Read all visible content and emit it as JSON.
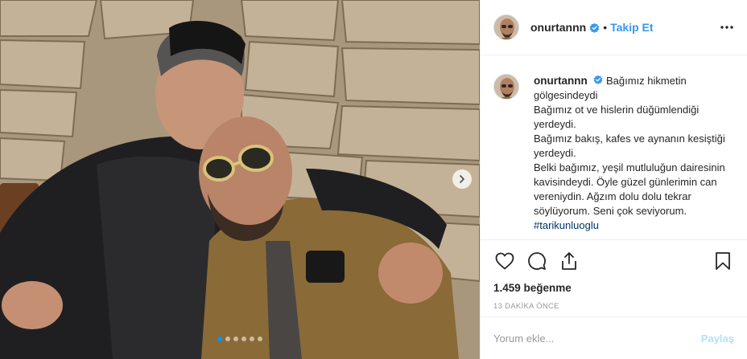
{
  "post": {
    "photo_alt": "Post photo",
    "carousel_count": 6,
    "carousel_active": 0
  },
  "header": {
    "username": "onurtannn",
    "separator": "•",
    "follow_label": "Takip Et"
  },
  "caption": {
    "username": "onurtannn",
    "lines": [
      "Bağımız hikmetin gölgesindeydi",
      "Bağımız ot ve hislerin düğümlendiği yerdeydi.",
      "Bağımız bakış, kafes ve aynanın kesiştiği yerdeydi.",
      "Belki bağımız, yeşil mutluluğun dairesinin kavisindeydi. Öyle güzel günlerimin can vereniydin. Ağzım dolu dolu tekrar söylüyorum. Seni çok seviyorum."
    ],
    "hashtag": "#tarikunluoglu"
  },
  "actions": {
    "like_icon": "heart-icon",
    "comment_icon": "comment-icon",
    "share_icon": "share-icon",
    "save_icon": "bookmark-icon"
  },
  "likes": "1.459 beğenme",
  "timestamp": "13 DAKİKA ÖNCE",
  "comment_box": {
    "placeholder": "Yorum ekle...",
    "post_label": "Paylaş"
  },
  "colors": {
    "verified": "#3897f0",
    "link": "#3897f0",
    "hashtag": "#003569",
    "post_disabled": "#b2dffc"
  }
}
